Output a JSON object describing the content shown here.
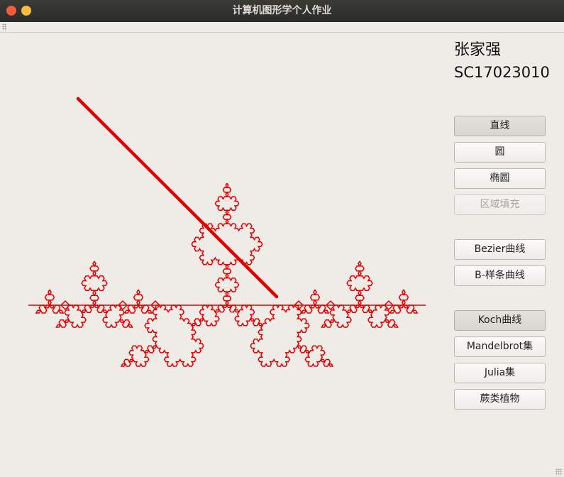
{
  "window": {
    "title": "计算机图形学个人作业"
  },
  "info": {
    "name": "张家强",
    "student_id": "SC17023010"
  },
  "buttons": {
    "line": "直线",
    "circle": "圆",
    "ellipse": "椭圆",
    "region_fill": "区域填充",
    "bezier": "Bezier曲线",
    "bspline": "B-样条曲线",
    "koch": "Koch曲线",
    "mandelbrot": "Mandelbrot集",
    "julia": "Julia集",
    "fern": "蕨类植物"
  },
  "colors": {
    "stroke": "#e00000",
    "background": "#efebe7"
  }
}
